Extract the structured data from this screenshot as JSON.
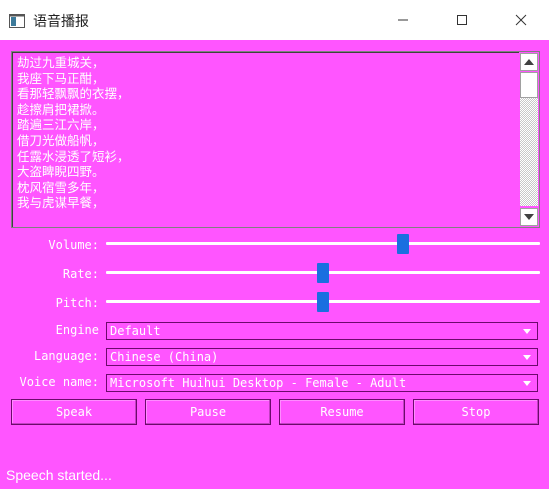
{
  "window": {
    "title": "语音播报",
    "icon": "app-window-icon"
  },
  "text_area": {
    "lines": [
      "劫过九重城关，",
      "我座下马正酣，",
      "看那轻飘飘的衣摆，",
      "趁擦肩把裙掀。",
      "踏遍三江六岸，",
      "借刀光做船帆，",
      "任露水浸透了短衫，",
      "大盗睥睨四野。",
      "枕风宿雪多年，",
      "我与虎谋早餐，"
    ]
  },
  "controls": {
    "volume": {
      "label": "Volume:",
      "value_fraction": 0.69
    },
    "rate": {
      "label": "Rate:",
      "value_fraction": 0.5
    },
    "pitch": {
      "label": "Pitch:",
      "value_fraction": 0.5
    },
    "engine": {
      "label": "Engine",
      "value": "Default"
    },
    "language": {
      "label": "Language:",
      "value": "Chinese (China)"
    },
    "voice": {
      "label": "Voice name:",
      "value": "Microsoft Huihui Desktop - Female - Adult"
    }
  },
  "buttons": {
    "speak": "Speak",
    "pause": "Pause",
    "resume": "Resume",
    "stop": "Stop"
  },
  "status": "Speech started...",
  "colors": {
    "background": "#ff55ff",
    "handle": "#1a6fe0",
    "text": "#ffffff"
  }
}
